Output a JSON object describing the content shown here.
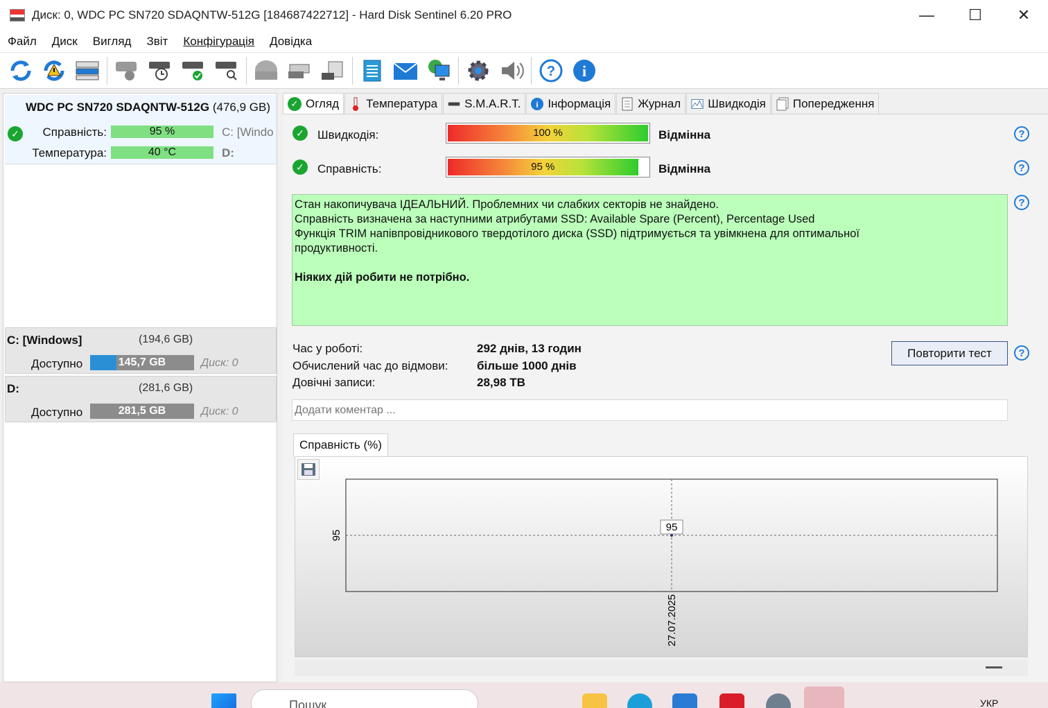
{
  "window": {
    "title": "Диск: 0, WDC PC SN720 SDAQNTW-512G [184687422712]  -  Hard Disk Sentinel 6.20 PRO",
    "minimize": "—",
    "maximize": "☐",
    "close": "✕"
  },
  "menu": [
    "Файл",
    "Диск",
    "Вигляд",
    "Звіт",
    "Конфігурація",
    "Довідка"
  ],
  "disk_card": {
    "name": "WDC PC SN720 SDAQNTW-512G",
    "size": "(476,9 GB)",
    "health_label": "Справність:",
    "health_value": "95 %",
    "temp_label": "Температура:",
    "temp_value": "40 °C",
    "drive_c": "C: [Windo",
    "drive_d": "D:"
  },
  "volumes": [
    {
      "name": "C: [Windows]",
      "size": "(194,6 GB)",
      "avail_label": "Доступно",
      "avail_value": "145,7 GB",
      "disk_label": "Диск: 0",
      "fill_fraction": 0.25
    },
    {
      "name": "D:",
      "size": "(281,6 GB)",
      "avail_label": "Доступно",
      "avail_value": "281,5 GB",
      "disk_label": "Диск: 0",
      "fill_fraction": 0
    }
  ],
  "tabs": [
    "Огляд",
    "Температура",
    "S.M.A.R.T.",
    "Інформація",
    "Журнал",
    "Швидкодія",
    "Попередження"
  ],
  "overview": {
    "performance_label": "Швидкодія:",
    "performance_value": "100 %",
    "performance_fraction": 1.0,
    "performance_result": "Відмінна",
    "health_label": "Справність:",
    "health_value": "95 %",
    "health_fraction": 0.95,
    "health_result": "Відмінна",
    "status_lines": [
      "Стан накопичувача ІДЕАЛЬНИЙ. Проблемних чи слабких секторів не знайдено.",
      "Справність визначена за наступними атрибутами SSD:  Available Spare (Percent), Percentage Used",
      "Функція TRIM напівпровідникового твердотілого диска (SSD) підтримується та увімкнена для оптимальної продуктивності."
    ],
    "status_action": "Ніяких дій робити не потрібно.",
    "uptime_label": "Час у роботі:",
    "uptime_value": "292 днів, 13 годин",
    "estimated_label": "Обчислений час до відмови:",
    "estimated_value": "більше 1000 днів",
    "writes_label": "Довічні записи:",
    "writes_value": "28,98 TB",
    "retest_button": "Повторити тест",
    "comment_placeholder": "Додати коментар ..."
  },
  "chart_tab": "Справність (%)",
  "chart_data": {
    "type": "line",
    "title": "",
    "x": [
      "27.07.2025"
    ],
    "series": [
      {
        "values": [
          95
        ]
      }
    ],
    "ytick": "95",
    "point_label": "95",
    "grid": true
  },
  "taskbar": {
    "search_placeholder": "Пошук",
    "language": "УКР"
  },
  "colors": {
    "status_bg": "#bbffbb",
    "ok_green": "#1aa531",
    "help_blue": "#1f7ad6"
  }
}
